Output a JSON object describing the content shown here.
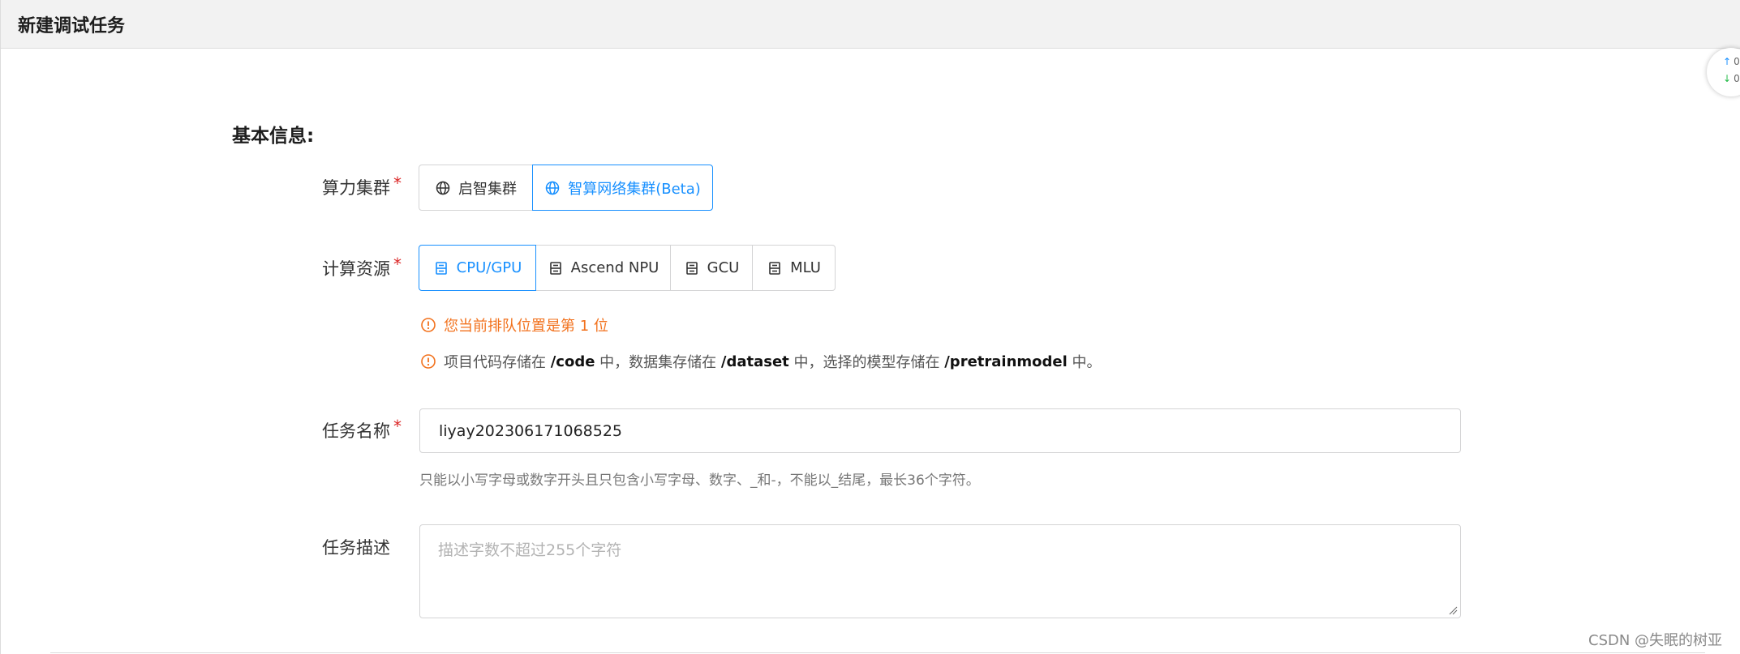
{
  "header": {
    "title": "新建调试任务"
  },
  "section": {
    "basic_info": "基本信息:"
  },
  "cluster": {
    "label": "算力集群",
    "required_mark": "*",
    "options": [
      {
        "label": "启智集群",
        "icon": "globe-icon"
      },
      {
        "label": "智算网络集群(Beta)",
        "icon": "globe-icon"
      }
    ],
    "selected": "智算网络集群(Beta)"
  },
  "resource": {
    "label": "计算资源",
    "required_mark": "*",
    "options": [
      {
        "label": "CPU/GPU",
        "icon": "server-icon"
      },
      {
        "label": "Ascend NPU",
        "icon": "server-icon"
      },
      {
        "label": "GCU",
        "icon": "server-icon"
      },
      {
        "label": "MLU",
        "icon": "server-icon"
      }
    ],
    "selected": "CPU/GPU"
  },
  "notices": {
    "queue": "您当前排队位置是第 1 位",
    "storage": {
      "t1": "项目代码存储在 ",
      "code": "/code",
      "t2": " 中，数据集存储在 ",
      "dataset": "/dataset",
      "t3": " 中，选择的模型存储在 ",
      "model": "/pretrainmodel",
      "t4": " 中。"
    },
    "colors": {
      "warning": "#f2711c"
    }
  },
  "task_name": {
    "label": "任务名称",
    "required_mark": "*",
    "value": "liyay202306171068525",
    "help": "只能以小写字母或数字开头且只包含小写字母、数字、_和-，不能以_结尾，最长36个字符。"
  },
  "task_desc": {
    "label": "任务描述",
    "placeholder": "描述字数不超过255个字符",
    "value": ""
  },
  "float_widget": {
    "up_value": "0",
    "down_value": "0"
  },
  "watermark": "CSDN @失眠的树亚",
  "accent_color": "#1890ff"
}
